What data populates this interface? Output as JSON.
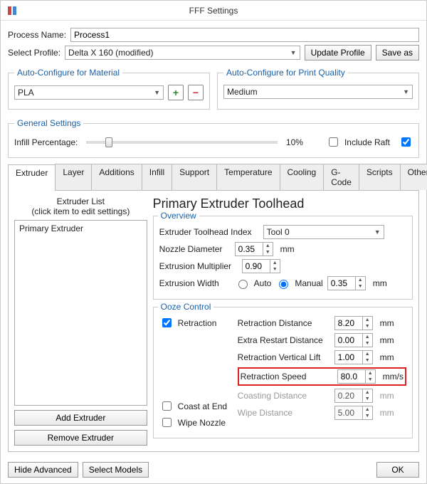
{
  "window": {
    "title": "FFF Settings"
  },
  "process": {
    "label": "Process Name:",
    "value": "Process1"
  },
  "profile": {
    "label": "Select Profile:",
    "value": "Delta X 160 (modified)",
    "update_btn": "Update Profile",
    "saveas_btn": "Save as"
  },
  "autocfg_material": {
    "legend": "Auto-Configure for Material",
    "value": "PLA"
  },
  "autocfg_quality": {
    "legend": "Auto-Configure for Print Quality",
    "value": "Medium"
  },
  "general": {
    "legend": "General Settings",
    "infill_label": "Infill Percentage:",
    "infill_value": "10%",
    "include_raft": "Include Raft"
  },
  "tabs": [
    "Extruder",
    "Layer",
    "Additions",
    "Infill",
    "Support",
    "Temperature",
    "Cooling",
    "G-Code",
    "Scripts",
    "Other"
  ],
  "extruder_list": {
    "header1": "Extruder List",
    "header2": "(click item to edit settings)",
    "items": [
      "Primary Extruder"
    ],
    "add_btn": "Add Extruder",
    "remove_btn": "Remove Extruder"
  },
  "panel": {
    "title": "Primary Extruder Toolhead",
    "overview": {
      "title": "Overview",
      "toolhead_label": "Extruder Toolhead Index",
      "toolhead_value": "Tool 0",
      "nozzle_label": "Nozzle Diameter",
      "nozzle_value": "0.35",
      "nozzle_unit": "mm",
      "mult_label": "Extrusion Multiplier",
      "mult_value": "0.90",
      "width_label": "Extrusion Width",
      "width_auto": "Auto",
      "width_manual": "Manual",
      "width_value": "0.35",
      "width_unit": "mm"
    },
    "ooze": {
      "title": "Ooze Control",
      "retraction": "Retraction",
      "coast": "Coast at End",
      "wipe": "Wipe Nozzle",
      "rows": {
        "rd": {
          "label": "Retraction Distance",
          "value": "8.20",
          "unit": "mm"
        },
        "erd": {
          "label": "Extra Restart Distance",
          "value": "0.00",
          "unit": "mm"
        },
        "rvl": {
          "label": "Retraction Vertical Lift",
          "value": "1.00",
          "unit": "mm"
        },
        "rs": {
          "label": "Retraction Speed",
          "value": "80.0",
          "unit": "mm/s"
        },
        "cd": {
          "label": "Coasting Distance",
          "value": "0.20",
          "unit": "mm"
        },
        "wd": {
          "label": "Wipe Distance",
          "value": "5.00",
          "unit": "mm"
        }
      }
    }
  },
  "footer": {
    "hide": "Hide Advanced",
    "select": "Select Models",
    "ok": "OK"
  }
}
